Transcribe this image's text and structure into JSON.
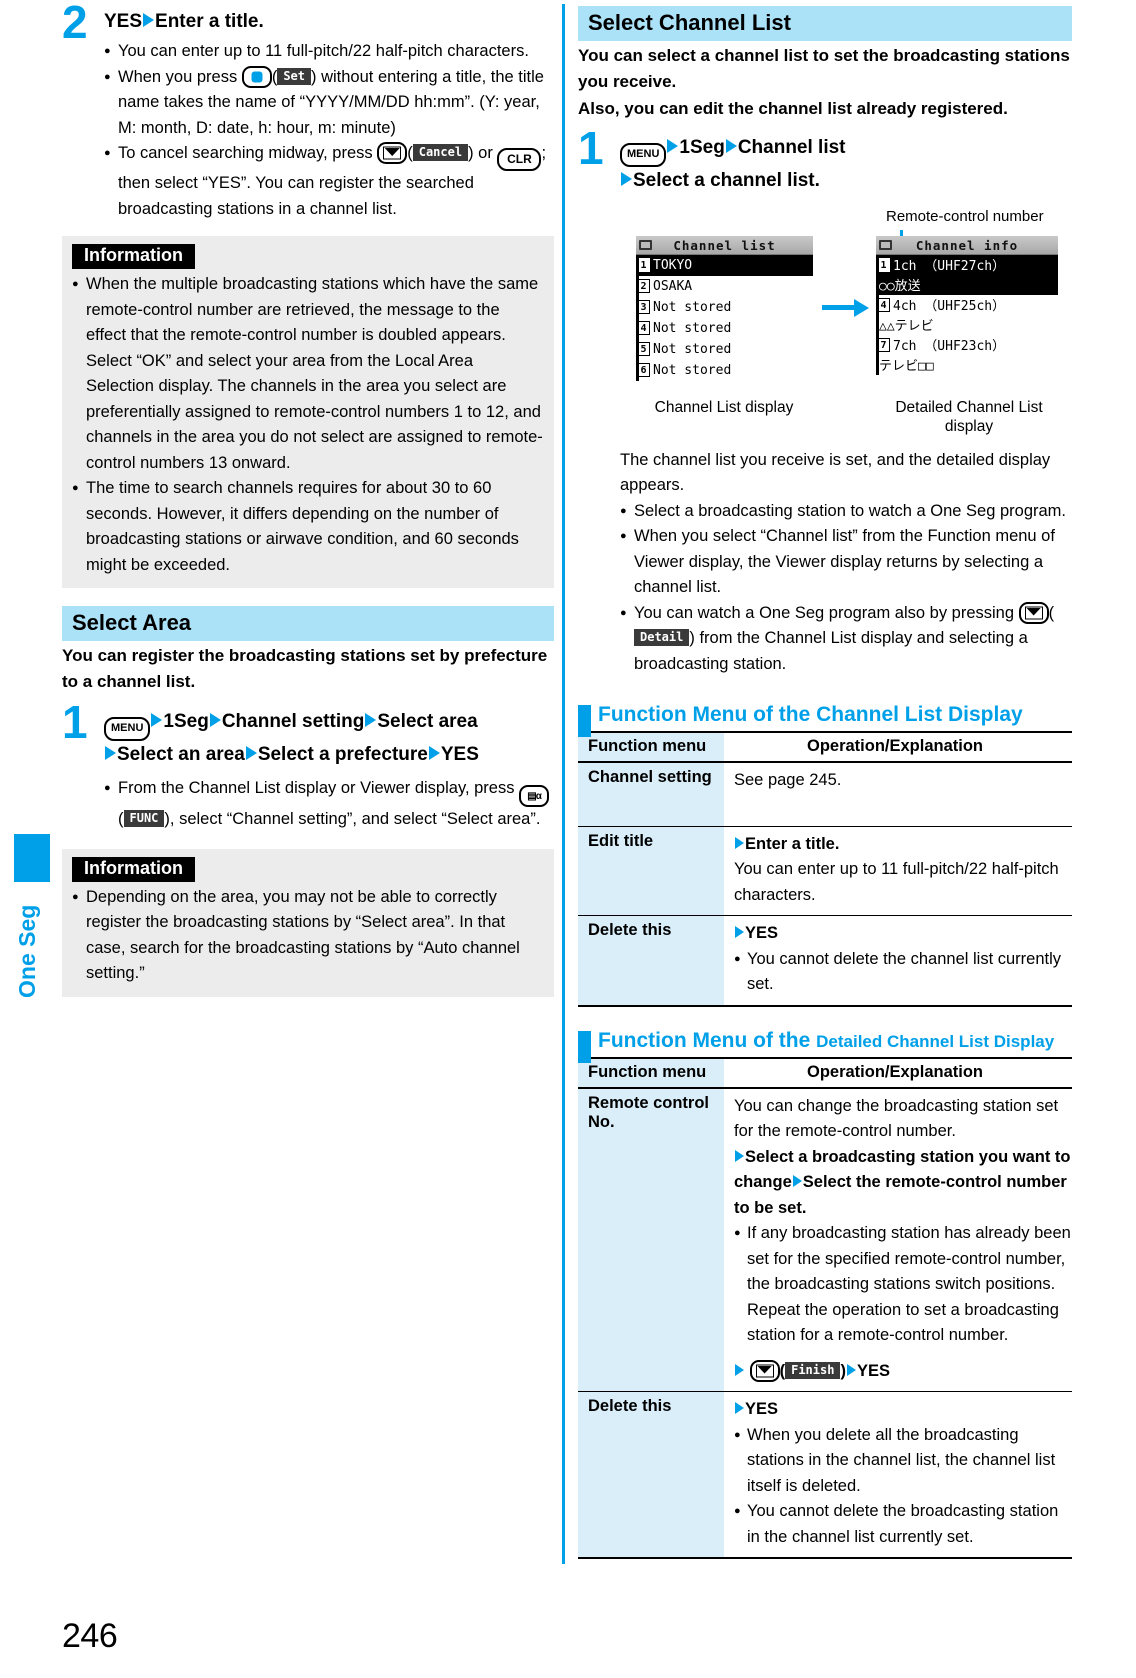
{
  "side_tab": {
    "label": "One Seg"
  },
  "page_number": "246",
  "left": {
    "step2": {
      "num": "2",
      "title_yes": "YES",
      "title_rest": "Enter a title.",
      "bullets": [
        "You can enter up to 11 full-pitch/22 half-pitch characters.",
        "When you press (Set) without entering a title, the title name takes the name of “YYYY/MM/DD hh:mm”. (Y: year, M: month, D: date, h: hour, m: minute)",
        "To cancel searching midway, press (Cancel) or CLR; then select “YES”. You can register the searched broadcasting stations in a channel list."
      ],
      "bullet2_pre": "When you press ",
      "bullet2_softkey": "Set",
      "bullet2_post": ") without entering a title, the title name takes the name of “YYYY/MM/DD hh:mm”. (Y: year, M: month, D: date, h: hour, m: minute)",
      "bullet3_pre": "To cancel searching midway, press ",
      "bullet3_softkey": "Cancel",
      "bullet3_key": "CLR",
      "bullet3_post": "; then select “YES”. You can register the searched broadcasting stations in a channel list."
    },
    "info1": {
      "title": "Information",
      "bullets": [
        "When the multiple broadcasting stations which have the same remote-control number are retrieved, the message to the effect that the remote-control number is doubled appears. Select “OK” and select your area from the Local Area Selection display. The channels in the area you select are preferentially assigned to remote-control numbers 1 to 12, and channels in the area you do not select are assigned to remote-control numbers 13 onward.",
        "The time to search channels requires for about 30 to 60 seconds. However, it differs depending on the number of broadcasting stations or airwave condition, and 60 seconds might be exceeded."
      ]
    },
    "select_area": {
      "heading": "Select Area",
      "lead": "You can register the broadcasting stations set by prefecture to a channel list.",
      "step_num": "1",
      "key_menu": "MENU",
      "path1_a": "1Seg",
      "path1_b": "Channel setting",
      "path1_c": "Select area",
      "path2_a": "Select an area",
      "path2_b": "Select a prefecture",
      "path2_c": "YES",
      "bullet_pre": "From the Channel List display or Viewer display, press ",
      "bullet_softkey": "FUNC",
      "bullet_post": "), select “Channel setting”, and select “Select area”."
    },
    "info2": {
      "title": "Information",
      "bullets": [
        "Depending on the area, you may not be able to correctly register the broadcasting stations by “Select area”. In that case, search for the broadcasting stations by “Auto channel setting.”"
      ]
    }
  },
  "right": {
    "select_channel_list": {
      "heading": "Select Channel List",
      "lead1": "You can select a channel list to set the broadcasting stations you receive.",
      "lead2": "Also, you can edit the channel list already registered.",
      "step_num": "1",
      "key_menu": "MENU",
      "path_a": "1Seg",
      "path_b": "Channel list",
      "path_c": "Select a channel list."
    },
    "figure": {
      "callout": "Remote-control number",
      "left_screen": {
        "title": "Channel list",
        "rows": [
          {
            "num": "1",
            "text": "TOKYO",
            "selected": true
          },
          {
            "num": "2",
            "text": "OSAKA",
            "selected": false
          },
          {
            "num": "3",
            "text": "Not stored",
            "selected": false
          },
          {
            "num": "4",
            "text": "Not stored",
            "selected": false
          },
          {
            "num": "5",
            "text": "Not stored",
            "selected": false
          },
          {
            "num": "6",
            "text": "Not stored",
            "selected": false
          }
        ],
        "caption": "Channel List display"
      },
      "right_screen": {
        "title": "Channel info",
        "rows": [
          {
            "num": "1",
            "text": "1ch （UHF27ch）",
            "sub": "○○放送",
            "selected": true
          },
          {
            "num": "4",
            "text": "4ch （UHF25ch）",
            "sub": "△△テレビ",
            "selected": false
          },
          {
            "num": "7",
            "text": "7ch （UHF23ch）",
            "sub": "テレビ□□",
            "selected": false
          }
        ],
        "caption_line1": "Detailed Channel List",
        "caption_line2": "display"
      }
    },
    "after_figure": {
      "para": "The channel list you receive is set, and the detailed display appears.",
      "bullets": [
        "Select a broadcasting station to watch a One Seg program.",
        "When you select “Channel list” from the Function menu of Viewer display, the Viewer display returns by selecting a channel list.",
        "You can watch a One Seg program also by pressing (Detail) from the Channel List display and selecting a broadcasting station."
      ],
      "bullet3_pre": "You can watch a One Seg program also by pressing ",
      "bullet3_softkey": "Detail",
      "bullet3_post": ") from the Channel List display and selecting a broadcasting station."
    },
    "table1": {
      "heading_t1": "Function Menu of the Channel List Display",
      "col1": "Function menu",
      "col2": "Operation/Explanation",
      "rows": [
        {
          "name": "Channel setting",
          "plain": "See page 245."
        },
        {
          "name": "Edit title",
          "arrow_bold": "Enter a title.",
          "plain": "You can enter up to 11 full-pitch/22 half-pitch characters."
        },
        {
          "name": "Delete this",
          "arrow_bold": "YES",
          "bullets": [
            "You cannot delete the channel list currently set."
          ]
        }
      ]
    },
    "table2": {
      "heading_t1": "Function Menu of the ",
      "heading_t2": "Detailed Channel List Display",
      "col1": "Function menu",
      "col2": "Operation/Explanation",
      "rows": [
        {
          "name": "Remote control No.",
          "plain": "You can change the broadcasting station set for the remote-control number.",
          "bold1": "Select a broadcasting station you want to change",
          "bold2": "Select the remote-control number to be set.",
          "bullets": [
            "If any broadcasting station has already been set for the specified remote-control number, the broadcasting stations switch positions. Repeat the operation to set a broadcasting station for a remote-control number."
          ],
          "finish_softkey": "Finish",
          "finish_yes": "YES"
        },
        {
          "name": "Delete this",
          "arrow_bold": "YES",
          "bullets": [
            "When you delete all the broadcasting stations in the channel list, the channel list itself is deleted.",
            "You cannot delete the broadcasting station in the channel list currently set."
          ]
        }
      ]
    }
  },
  "colors": {
    "accent": "#00A0E9",
    "band": "#ACE2F7",
    "table_head": "#DAEEF9",
    "info_bg": "#ECECEC"
  }
}
